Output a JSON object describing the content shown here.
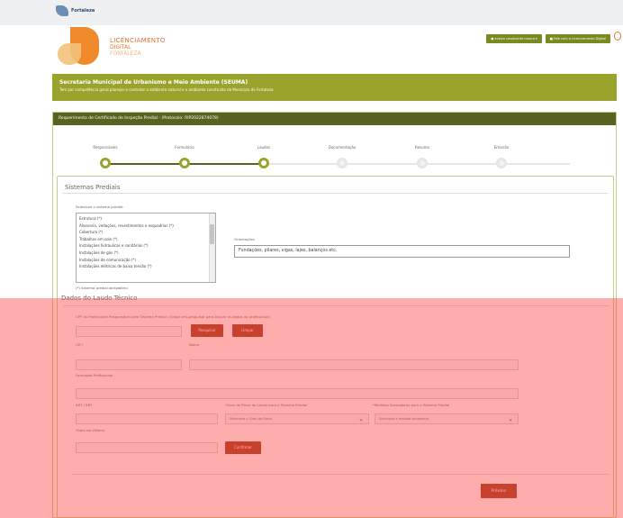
{
  "header": {
    "logo_text": "Fortaleza",
    "brand_title": "LICENCIAMENTO",
    "brand_sub1": "DIGITAL",
    "brand_sub2": "FORTALEZA",
    "user_button": "evelyn cavalcante moura",
    "chat_button": "Fale com o Licenciamento Digital"
  },
  "banner": {
    "title": "Secretaria Municipal de Urbanismo e Meio Ambiente (SEUMA)",
    "subtitle": "Tem por competência geral planejar e controlar o ambiente natural e o ambiente construído do Município de Fortaleza."
  },
  "card": {
    "header": "Requerimento de Certificado de Inspeção Predial - (Protocolo: RIP2022874078)"
  },
  "steps": [
    {
      "label": "Responsáveis",
      "done": true
    },
    {
      "label": "Formulário",
      "done": true
    },
    {
      "label": "Laudos",
      "done": true
    },
    {
      "label": "Documentação",
      "done": false
    },
    {
      "label": "Resumo",
      "done": false
    },
    {
      "label": "Emissão",
      "done": false
    }
  ],
  "sistemas": {
    "title": "Sistemas Prediais",
    "select_label": "Selecione o sistema predial:",
    "options": [
      "Estrutura (*)",
      "Alvenaria, vedações, revestimentos e esquadrias (*)",
      "Cobertura (*)",
      "Trabalhos em solo (*)",
      "Instalações hidráulicas e sanitárias (*)",
      "Instalações de gás (*)",
      "Instalações de comunicação (*)",
      "Instalações elétricas de baixa tensão (*)"
    ],
    "required_note": "(*) Sistema predial obrigatório",
    "orientacoes_label": "Orientações",
    "orientacoes_value": "Fundações, pilares, vigas, lajes, balanços etc."
  },
  "laudo": {
    "title": "Dados do Laudo Técnico",
    "cpf_hint": "CPF do Profissional Responsável pelo Sistema Predial: (Clique em pesquisar para buscar os dados do profissional)",
    "pesquisar": "Pesquisar",
    "limpar": "Limpar",
    "uf_label": "(UF)",
    "nome_label": "Nome",
    "formacao_label": "Formação Profissional",
    "art_label": "ART / RRT",
    "grau_label": "*Grau de Risco do Laudo para o Sistema Predial",
    "grau_placeholder": "Selecione o Grau de Risco",
    "medidas_label": "*Medidas Saneadoras para o Sistema Predial",
    "medidas_placeholder": "Selecione a medida saneadora",
    "data_label": "*Data da Vistoria",
    "confirmar": "Confirmar",
    "proximo": "Próximo"
  }
}
